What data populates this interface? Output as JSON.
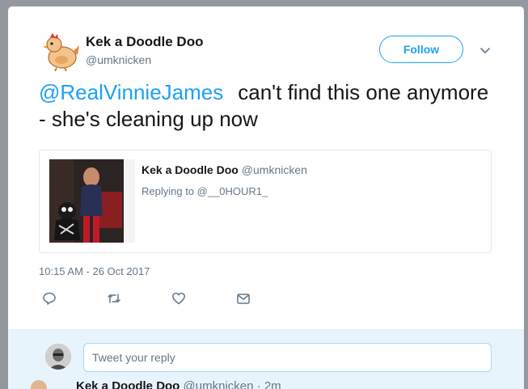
{
  "tweet": {
    "author_name": "Kek a Doodle Doo",
    "author_handle": "@umknicken",
    "follow_label": "Follow",
    "mention": "@RealVinnieJames",
    "text": "can't find this one anymore - she's cleaning up now",
    "timestamp": "10:15 AM - 26 Oct 2017"
  },
  "quoted": {
    "author_name": "Kek a Doodle Doo",
    "author_handle": "@umknicken",
    "replying_to": "Replying to @__0HOUR1_"
  },
  "actions": {
    "reply_icon": "reply-icon",
    "retweet_icon": "retweet-icon",
    "like_icon": "heart-icon",
    "dm_icon": "envelope-icon"
  },
  "reply_box": {
    "placeholder": "Tweet your reply"
  },
  "peek": {
    "author_name": "Kek a Doodle Doo",
    "author_handle": "@umknicken",
    "time": "2m"
  },
  "colors": {
    "accent": "#1da1f2",
    "text": "#14171a",
    "muted": "#657786",
    "reply_bar_bg": "#e8f4fb"
  }
}
